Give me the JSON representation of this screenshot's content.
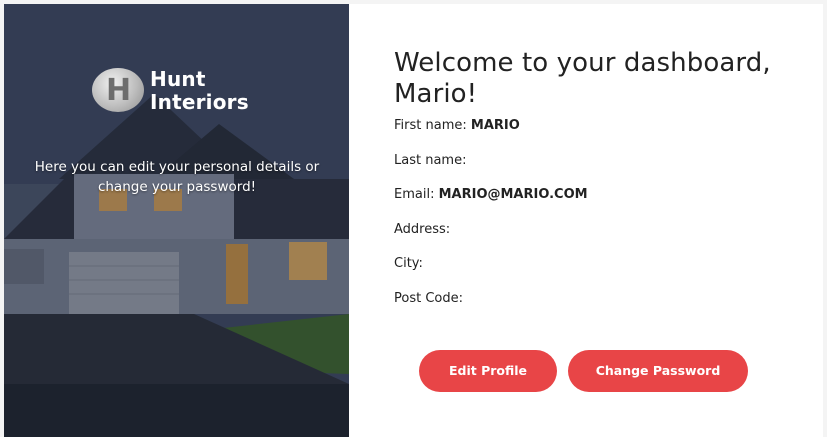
{
  "brand": {
    "logo_letter": "H",
    "name_line1": "Hunt",
    "name_line2": "Interiors"
  },
  "hero": {
    "caption": "Here you can edit your personal details or change your password!"
  },
  "dashboard": {
    "title": "Welcome to your dashboard, Mario!",
    "fields": [
      {
        "label": "First name:",
        "value": "MARIO"
      },
      {
        "label": "Last name:",
        "value": ""
      },
      {
        "label": "Email:",
        "value": "MARIO@MARIO.COM"
      },
      {
        "label": "Address:",
        "value": ""
      },
      {
        "label": "City:",
        "value": ""
      },
      {
        "label": "Post Code:",
        "value": ""
      }
    ]
  },
  "actions": {
    "edit_profile": "Edit Profile",
    "change_password": "Change Password"
  },
  "colors": {
    "accent": "#e84547",
    "text": "#222222"
  }
}
